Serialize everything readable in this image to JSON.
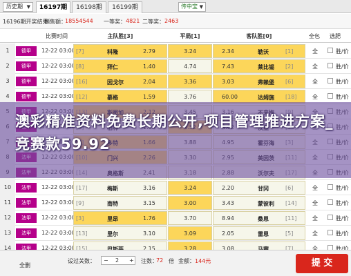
{
  "topbar": {
    "history": "历史期",
    "tabs": [
      "16197期",
      "16198期",
      "16199期"
    ],
    "game_select": "传中宝"
  },
  "infobar": {
    "period_status": "16196期开奖结果",
    "sales_label": "销售额：",
    "sales_value": "18554544",
    "first_prize_label": "一等奖：",
    "first_prize_value": "4821",
    "second_prize_label": "二等奖：",
    "second_prize_value": "2463"
  },
  "header": {
    "match_time": "比赛时间",
    "home": "主队胜[3]",
    "draw": "平局[1]",
    "away": "客队胜[0]",
    "all": "全包",
    "select": "选肥"
  },
  "colors": {
    "league": "#b5008a",
    "highlight": "#fcd65a",
    "submit": "#d9261c"
  },
  "rows": [
    {
      "num": "1",
      "league": "德甲",
      "time": "12-22 03:00",
      "home_rank": "[7]",
      "home_team": "科隆",
      "home_odds": "2.79",
      "draw": "3.24",
      "away_odds": "2.34",
      "away_team": "勒沃",
      "away_rank": "[1]",
      "all": "全",
      "select": "胜/价",
      "hl": [
        "home",
        "draw",
        "away"
      ]
    },
    {
      "num": "2",
      "league": "德甲",
      "time": "12-22 03:00",
      "home_rank": "[8]",
      "home_team": "拜仁",
      "home_odds": "1.40",
      "draw": "4.74",
      "away_odds": "7.43",
      "away_team": "莱比锡",
      "away_rank": "[2]",
      "all": "全",
      "select": "胜/价",
      "hl": [
        "home",
        "away"
      ]
    },
    {
      "num": "3",
      "league": "德甲",
      "time": "12-22 03:00",
      "home_rank": "[16]",
      "home_team": "因戈尔",
      "home_odds": "2.04",
      "draw": "3.36",
      "away_odds": "3.03",
      "away_team": "弗赖堡",
      "away_rank": "[6]",
      "all": "全",
      "select": "胜/价",
      "hl": [
        "home",
        "draw",
        "away"
      ]
    },
    {
      "num": "4",
      "league": "德甲",
      "time": "12-22 03:00",
      "home_rank": "[12]",
      "home_team": "慕格",
      "home_odds": "1.59",
      "draw": "3.76",
      "away_odds": "60.00",
      "away_team": "达姆施",
      "away_rank": "[18]",
      "all": "全",
      "select": "胜/价",
      "hl": [
        "home",
        "away"
      ]
    },
    {
      "num": "5",
      "league": "德甲",
      "time": "12-22 03:00",
      "home_rank": "[13]",
      "home_team": "斯图加",
      "home_odds": "2.12",
      "draw": "3.45",
      "away_odds": "3.16",
      "away_team": "不来梅",
      "away_rank": "[9]",
      "all": "全",
      "select": "胜/价",
      "hl": [
        "home"
      ]
    },
    {
      "num": "6",
      "league": "德甲",
      "time": "12-22 03:00",
      "home_rank": "[5]",
      "home_team": "柏林",
      "home_odds": "1.85",
      "draw": "3.52",
      "away_odds": "4.02",
      "away_team": "汉堡",
      "away_rank": "[15]",
      "all": "全",
      "select": "胜/价",
      "hl": [
        "draw"
      ]
    },
    {
      "num": "7",
      "league": "法甲",
      "time": "12-22 03:00",
      "home_rank": "[4]",
      "home_team": "多特",
      "home_odds": "1.66",
      "draw": "3.88",
      "away_odds": "4.95",
      "away_team": "霍芬海",
      "away_rank": "[3]",
      "all": "全",
      "select": "胜/价",
      "hl": [
        "home"
      ]
    },
    {
      "num": "8",
      "league": "法甲",
      "time": "12-22 03:00",
      "home_rank": "[10]",
      "home_team": "门兴",
      "home_odds": "2.26",
      "draw": "3.30",
      "away_odds": "2.95",
      "away_team": "美因茨",
      "away_rank": "[11]",
      "all": "全",
      "select": "胜/价",
      "hl": [
        "home"
      ]
    },
    {
      "num": "9",
      "league": "法甲",
      "time": "12-22 03:00",
      "home_rank": "[14]",
      "home_team": "奥格斯",
      "home_odds": "2.41",
      "draw": "3.18",
      "away_odds": "2.88",
      "away_team": "沃尔夫",
      "away_rank": "[17]",
      "all": "全",
      "select": "胜/价",
      "hl": []
    },
    {
      "num": "10",
      "league": "法甲",
      "time": "12-22 03:00",
      "home_rank": "[17]",
      "home_team": "梅斯",
      "home_odds": "3.16",
      "draw": "3.24",
      "away_odds": "2.20",
      "away_team": "甘冈",
      "away_rank": "[6]",
      "all": "全",
      "select": "胜/价",
      "hl": [
        "draw"
      ]
    },
    {
      "num": "11",
      "league": "法甲",
      "time": "12-22 03:00",
      "home_rank": "[9]",
      "home_team": "南特",
      "home_odds": "3.15",
      "draw": "3.00",
      "away_odds": "3.43",
      "away_team": "蒙彼利",
      "away_rank": "[14]",
      "all": "全",
      "select": "胜/价",
      "hl": [
        "draw"
      ]
    },
    {
      "num": "12",
      "league": "法甲",
      "time": "12-22 03:00",
      "home_rank": "[3]",
      "home_team": "里昂",
      "home_odds": "1.76",
      "draw": "3.70",
      "away_odds": "8.94",
      "away_team": "桑恩",
      "away_rank": "[11]",
      "all": "全",
      "select": "胜/价",
      "hl": [
        "home"
      ]
    },
    {
      "num": "13",
      "league": "法甲",
      "time": "12-22 03:00",
      "home_rank": "[13]",
      "home_team": "里尔",
      "home_odds": "3.10",
      "draw": "3.09",
      "away_odds": "2.05",
      "away_team": "雷恩",
      "away_rank": "[5]",
      "all": "全",
      "select": "胜/价",
      "hl": [
        "draw"
      ]
    },
    {
      "num": "14",
      "league": "法甲",
      "time": "12-22 03:00",
      "home_rank": "[15]",
      "home_team": "巴斯蒂",
      "home_odds": "2.15",
      "draw": "3.28",
      "away_odds": "3.08",
      "away_team": "马赛",
      "away_rank": "[7]",
      "all": "全",
      "select": "胜/价",
      "hl": [
        "draw"
      ]
    }
  ],
  "bottombar": {
    "clear": "全删",
    "pass_label": "设过关数：",
    "pass_value": "2",
    "notes_label": "注数：",
    "notes_value": "72",
    "multiple_label": "倍",
    "amount_label": "金额：",
    "amount_value": "144元",
    "submit": "提 交"
  },
  "overlay": {
    "text": "澳彩精准资料免费长期公开,项目管理推进方案_竞赛款59.92"
  }
}
